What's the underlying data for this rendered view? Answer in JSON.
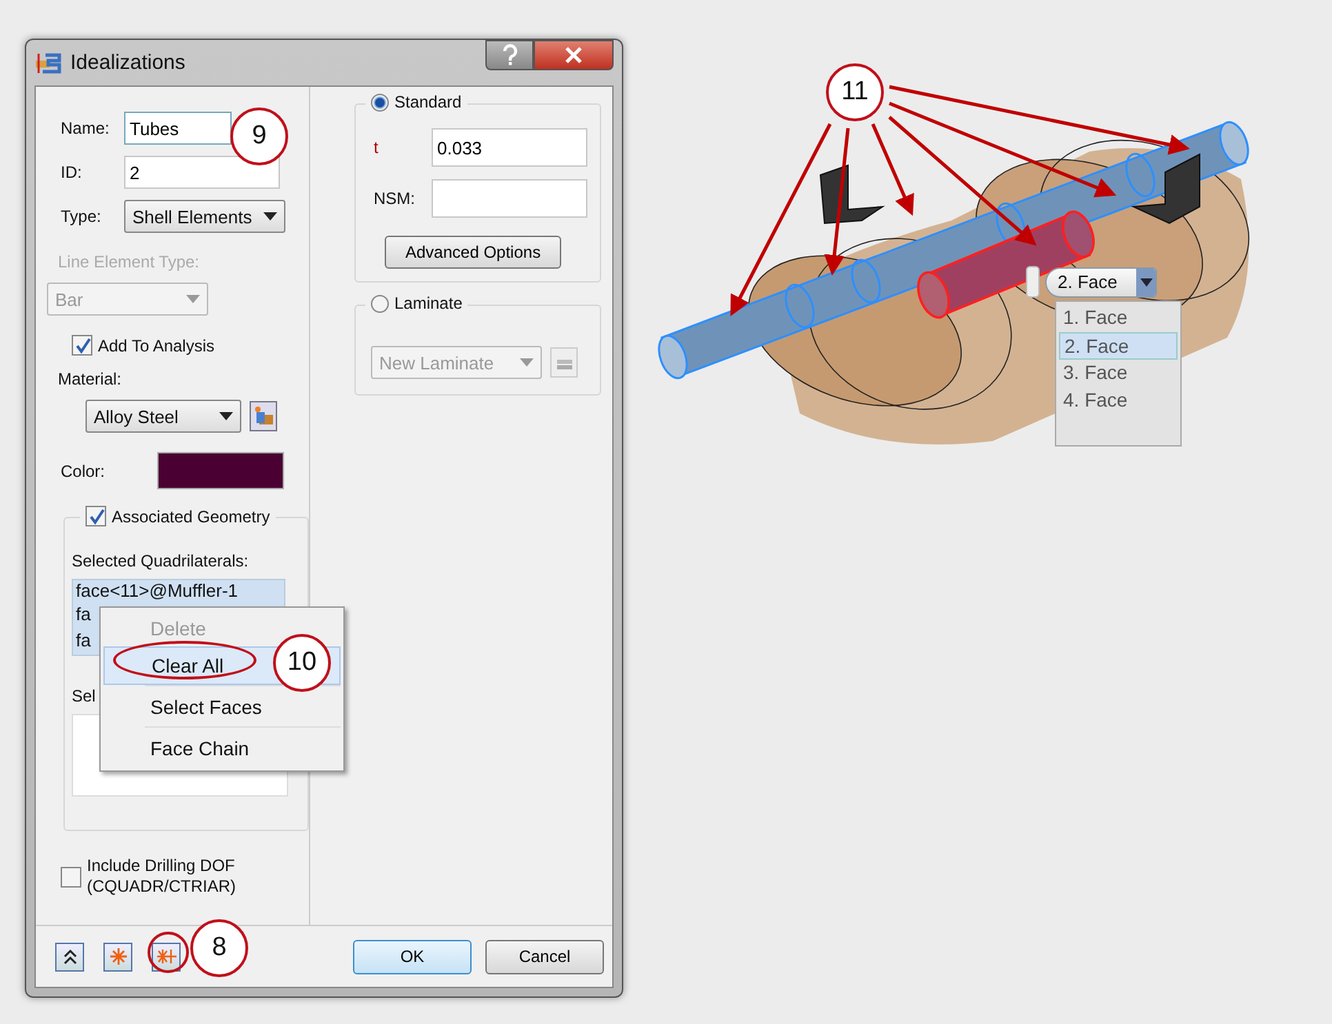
{
  "window": {
    "title": "Idealizations"
  },
  "fields": [
    {
      "kind": "text",
      "label": "Name:",
      "value": "Tubes"
    },
    {
      "kind": "text",
      "label": "ID:",
      "value": "2"
    },
    {
      "kind": "dropdown",
      "label": "Type:",
      "value": "Shell Elements",
      "disabled": false
    },
    {
      "kind": "dropdown",
      "label": "Line Element Type:",
      "value": "Bar",
      "disabled": true
    }
  ],
  "add_to_analysis": {
    "label": "Add To Analysis",
    "checked": true
  },
  "material": {
    "label": "Material:",
    "value": "Alloy Steel"
  },
  "color": {
    "label": "Color:",
    "color": "#4a0033"
  },
  "associated_geometry": {
    "label": "Associated Geometry",
    "checked": true,
    "list_label": "Selected Quadrilaterals:",
    "items": [
      "face<11>@Muffler-1",
      "fa",
      "fa"
    ],
    "second_label": "Sel"
  },
  "include_drilling_dof": {
    "lines": [
      "Include Drilling DOF",
      "(CQUADR/CTRIAR)"
    ],
    "checked": false
  },
  "standard": {
    "label": "Standard",
    "selected": true,
    "t_label": "t",
    "t_value": "0.033",
    "nsm_label": "NSM:",
    "button": "Advanced Options"
  },
  "laminate": {
    "label": "Laminate",
    "selected": false,
    "dropdown": "New Laminate"
  },
  "buttons": [
    {
      "label": "OK",
      "default": true
    },
    {
      "label": "Cancel",
      "default": false
    }
  ],
  "context_menu": [
    {
      "label": "Delete",
      "disabled": true,
      "highlighted": false
    },
    {
      "label": "Clear All",
      "disabled": false,
      "highlighted": true
    },
    {
      "label": "Select Faces",
      "disabled": false,
      "highlighted": false
    },
    {
      "label": "Face Chain",
      "disabled": false,
      "highlighted": false
    }
  ],
  "face_selector": {
    "value": "2. Face",
    "options": [
      {
        "label": "1. Face",
        "selected": false
      },
      {
        "label": "2. Face",
        "selected": true
      },
      {
        "label": "3. Face",
        "selected": false
      },
      {
        "label": "4. Face",
        "selected": false
      }
    ]
  },
  "callouts": [
    "9",
    "10",
    "8",
    "11"
  ]
}
